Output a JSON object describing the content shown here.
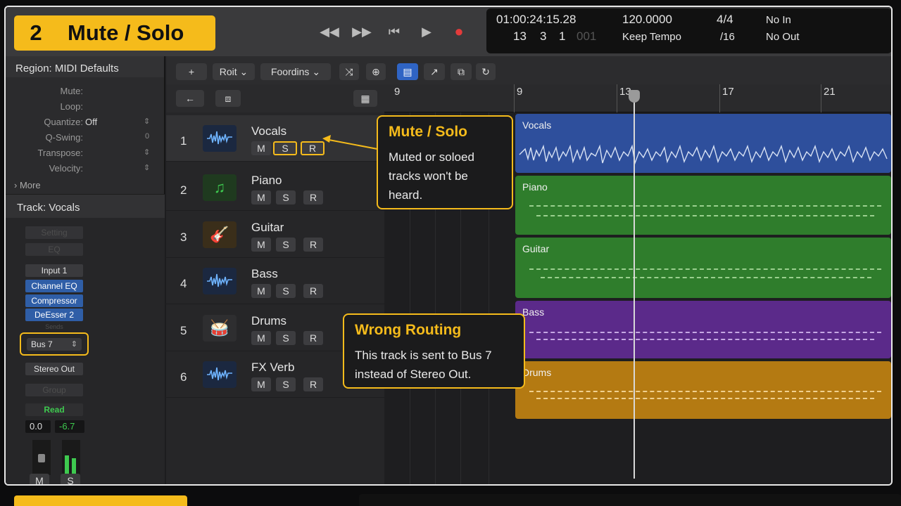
{
  "step": {
    "number": "2",
    "title": "Mute / Solo"
  },
  "transport": {
    "rewind": "◀◀",
    "forward": "▶▶",
    "to_start": "⏮",
    "play": "▶",
    "record": "●"
  },
  "lcd": {
    "time": "01:00:24:15.28",
    "bars": "13",
    "beat": "3",
    "div": "1",
    "tick": "001",
    "tempo": "120.0000",
    "tempo_mode": "Keep Tempo",
    "signature": "4/4",
    "division": "/16",
    "midi_in": "No In",
    "midi_out": "No Out"
  },
  "region_inspector": {
    "title": "Region: MIDI Defaults",
    "rows": [
      {
        "label": "Mute:",
        "value": ""
      },
      {
        "label": "Loop:",
        "value": ""
      },
      {
        "label": "Quantize:",
        "value": "Off"
      },
      {
        "label": "Q-Swing:",
        "value": "0"
      },
      {
        "label": "Transpose:",
        "value": ""
      },
      {
        "label": "Velocity:",
        "value": ""
      }
    ],
    "more": "More"
  },
  "track_inspector": {
    "title": "Track:  Vocals",
    "setting": "Setting",
    "eq": "EQ",
    "input": "Input 1",
    "plugins": [
      "Channel EQ",
      "Compressor",
      "DeEsser 2"
    ],
    "sends_label": "Sends",
    "output": "Bus 7",
    "stereo_out": "Stereo Out",
    "group": "Group",
    "automation": "Read",
    "volume": "0.0",
    "peak": "-6.7",
    "mute": "M",
    "solo": "S"
  },
  "toolbar": {
    "add": "+",
    "edit_menu": "Roit",
    "functions_menu": "Foordins"
  },
  "ruler": {
    "bars": [
      "9",
      "9",
      "13",
      "17",
      "21"
    ]
  },
  "tracks": [
    {
      "num": "1",
      "name": "Vocals",
      "icon": "waveform-icon"
    },
    {
      "num": "2",
      "name": "Piano",
      "icon": "music-note-icon"
    },
    {
      "num": "3",
      "name": "Guitar",
      "icon": "guitar-icon"
    },
    {
      "num": "4",
      "name": "Bass",
      "icon": "waveform-icon"
    },
    {
      "num": "5",
      "name": "Drums",
      "icon": "drum-kit-icon"
    },
    {
      "num": "6",
      "name": "FX Verb",
      "icon": "waveform-icon"
    }
  ],
  "track_buttons": {
    "mute": "M",
    "solo": "S",
    "record": "R"
  },
  "regions": [
    {
      "name": "Vocals",
      "color": "#2e4f9c"
    },
    {
      "name": "Piano",
      "color": "#2f7d2c"
    },
    {
      "name": "Guitar",
      "color": "#2f7d2c"
    },
    {
      "name": "Bass",
      "color": "#5b2a8a"
    },
    {
      "name": "Drums",
      "color": "#b47a12"
    }
  ],
  "callouts": {
    "mute_solo": {
      "title": "Mute / Solo",
      "body": [
        "Muted or soloed",
        "tracks won't be",
        "heard."
      ]
    },
    "routing": {
      "title": "Wrong Routing",
      "body": [
        "This track is sent to Bus 7",
        "instead of Stereo Out."
      ]
    }
  },
  "colors": {
    "accent": "#f5bb1b",
    "selected_tool": "#2f64c4"
  }
}
